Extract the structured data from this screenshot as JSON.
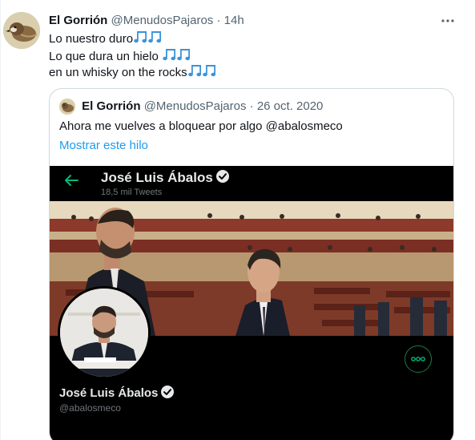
{
  "tweet": {
    "author_name": "El Gorrión",
    "author_handle": "@MenudosPajaros",
    "separator": "·",
    "time": "14h",
    "lines": [
      "Lo nuestro duro",
      "Lo que dura un hielo ",
      "en un whisky on the rocks"
    ],
    "emoji": "music-notes-icon"
  },
  "quote": {
    "author_name": "El Gorrión",
    "author_handle": "@MenudosPajaros",
    "separator": "·",
    "date": "26 oct. 2020",
    "text": "Ahora me vuelves a bloquear por algo @abalosmeco",
    "show_thread": "Mostrar este hilo"
  },
  "screenshot": {
    "profile_name": "José Luis Ábalos",
    "tweet_count": "18,5 mil Tweets",
    "handle": "@abalosmeco"
  },
  "colors": {
    "link": "#1d9bf0",
    "back_arrow": "#00ba7c",
    "dark_bg": "#000000"
  }
}
